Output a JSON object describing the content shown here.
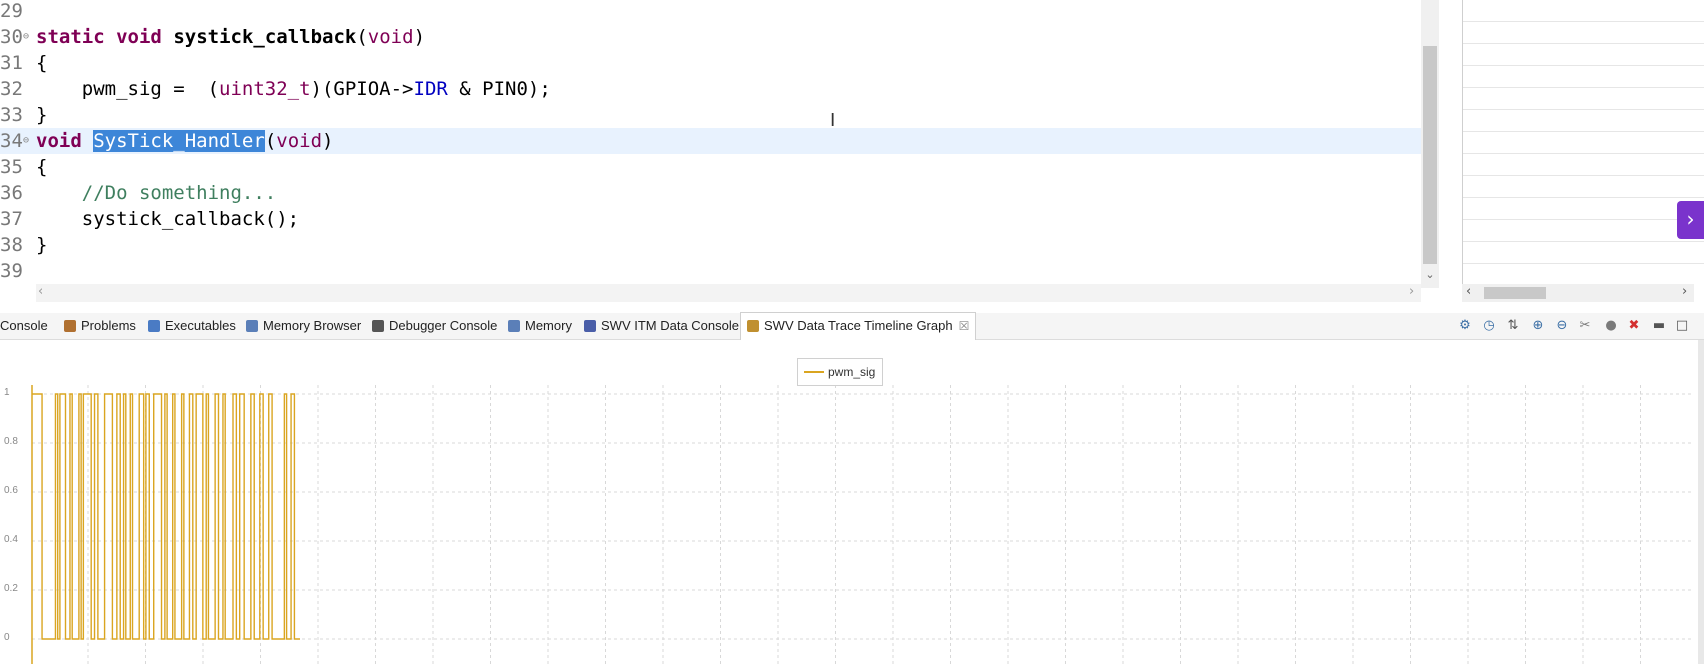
{
  "editor": {
    "lines": [
      {
        "num": "29",
        "fold": "",
        "current": false,
        "tokens": []
      },
      {
        "num": "30",
        "fold": "⊖",
        "current": false,
        "tokens": [
          {
            "c": "kw",
            "t": "static"
          },
          {
            "c": "",
            "t": " "
          },
          {
            "c": "kw",
            "t": "void"
          },
          {
            "c": "",
            "t": " "
          },
          {
            "c": "b",
            "t": "systick_callback"
          },
          {
            "c": "",
            "t": "("
          },
          {
            "c": "ty",
            "t": "void"
          },
          {
            "c": "",
            "t": ")"
          }
        ]
      },
      {
        "num": "31",
        "fold": "",
        "current": false,
        "tokens": [
          {
            "c": "",
            "t": "{"
          }
        ]
      },
      {
        "num": "32",
        "fold": "",
        "current": false,
        "tokens": [
          {
            "c": "",
            "t": "    pwm_sig =  ("
          },
          {
            "c": "ty",
            "t": "uint32_t"
          },
          {
            "c": "",
            "t": ")(GPIOA->"
          },
          {
            "c": "mac",
            "t": "IDR"
          },
          {
            "c": "",
            "t": " & PIN0);"
          }
        ]
      },
      {
        "num": "33",
        "fold": "",
        "current": false,
        "tokens": [
          {
            "c": "",
            "t": "}"
          }
        ]
      },
      {
        "num": "34",
        "fold": "⊖",
        "current": true,
        "tokens": [
          {
            "c": "kw",
            "t": "void"
          },
          {
            "c": "",
            "t": " "
          },
          {
            "c": "sel",
            "t": "SysTick_Handler"
          },
          {
            "c": "",
            "t": "("
          },
          {
            "c": "ty",
            "t": "void"
          },
          {
            "c": "",
            "t": ")"
          }
        ]
      },
      {
        "num": "35",
        "fold": "",
        "current": false,
        "tokens": [
          {
            "c": "",
            "t": "{"
          }
        ]
      },
      {
        "num": "36",
        "fold": "",
        "current": false,
        "tokens": [
          {
            "c": "",
            "t": "    "
          },
          {
            "c": "cm",
            "t": "//Do something..."
          }
        ]
      },
      {
        "num": "37",
        "fold": "",
        "current": false,
        "tokens": [
          {
            "c": "",
            "t": "    systick_callback();"
          }
        ]
      },
      {
        "num": "38",
        "fold": "",
        "current": false,
        "tokens": [
          {
            "c": "",
            "t": "}"
          }
        ]
      },
      {
        "num": "39",
        "fold": "",
        "current": false,
        "tokens": []
      }
    ],
    "cursor_glyph": "I"
  },
  "tabs": [
    {
      "label": "Console",
      "icon": "console-icon",
      "active": false
    },
    {
      "label": "Problems",
      "icon": "problems-icon",
      "active": false
    },
    {
      "label": "Executables",
      "icon": "executables-icon",
      "active": false
    },
    {
      "label": "Memory Browser",
      "icon": "memory-browser-icon",
      "active": false
    },
    {
      "label": "Debugger Console",
      "icon": "debugger-console-icon",
      "active": false
    },
    {
      "label": "Memory",
      "icon": "memory-icon",
      "active": false
    },
    {
      "label": "SWV ITM Data Console",
      "icon": "swv-itm-icon",
      "active": false
    },
    {
      "label": "SWV Data Trace Timeline Graph",
      "icon": "timeline-graph-icon",
      "active": true,
      "close": "☒"
    }
  ],
  "toolbar_icons": [
    {
      "name": "configure-trace-icon",
      "glyph": "⚙",
      "color": "#3a6ea5"
    },
    {
      "name": "time-icon",
      "glyph": "◷",
      "color": "#3a6ea5"
    },
    {
      "name": "adjust-y-axis-icon",
      "glyph": "⇅",
      "color": "#555555"
    },
    {
      "name": "zoom-in-icon",
      "glyph": "⊕",
      "color": "#3a6ea5"
    },
    {
      "name": "zoom-out-icon",
      "glyph": "⊖",
      "color": "#3a6ea5"
    },
    {
      "name": "tools-icon",
      "glyph": "✂",
      "color": "#777777"
    },
    {
      "name": "record-icon",
      "glyph": "●",
      "color": "#7a7a7a"
    },
    {
      "name": "remove-all-icon",
      "glyph": "✖",
      "color": "#d32f2f"
    },
    {
      "name": "minimize-icon",
      "glyph": "▬",
      "color": "#555555"
    },
    {
      "name": "maximize-icon",
      "glyph": "□",
      "color": "#555555"
    }
  ],
  "chart_data": {
    "type": "line",
    "series": [
      {
        "name": "pwm_sig",
        "color": "#daa520"
      }
    ],
    "ylim": [
      0,
      1
    ],
    "yticks": [
      "1",
      "0.8",
      "0.6",
      "0.4",
      "0.2",
      "0"
    ],
    "grid": true,
    "legend_position": "top-center",
    "step_transitions": [
      {
        "t": 0.0,
        "v": 1
      },
      {
        "t": 0.5,
        "v": 1
      },
      {
        "t": 0.9,
        "v": 0
      },
      {
        "t": 1.7,
        "v": 0
      },
      {
        "t": 2.1,
        "v": 1
      },
      {
        "t": 2.3,
        "v": 0
      },
      {
        "t": 2.5,
        "v": 1
      },
      {
        "t": 3.0,
        "v": 0
      },
      {
        "t": 3.4,
        "v": 1
      },
      {
        "t": 3.6,
        "v": 0
      },
      {
        "t": 4.2,
        "v": 1
      },
      {
        "t": 4.4,
        "v": 0
      },
      {
        "t": 4.6,
        "v": 1
      },
      {
        "t": 5.3,
        "v": 0
      },
      {
        "t": 5.6,
        "v": 1
      },
      {
        "t": 5.9,
        "v": 0
      },
      {
        "t": 6.5,
        "v": 1
      },
      {
        "t": 7.2,
        "v": 0
      },
      {
        "t": 7.6,
        "v": 1
      },
      {
        "t": 7.9,
        "v": 0
      },
      {
        "t": 8.2,
        "v": 1
      },
      {
        "t": 8.4,
        "v": 0
      },
      {
        "t": 8.8,
        "v": 1
      },
      {
        "t": 9.0,
        "v": 0
      },
      {
        "t": 9.6,
        "v": 1
      },
      {
        "t": 10.0,
        "v": 0
      },
      {
        "t": 10.2,
        "v": 1
      },
      {
        "t": 10.5,
        "v": 0
      },
      {
        "t": 10.9,
        "v": 1
      },
      {
        "t": 11.6,
        "v": 0
      },
      {
        "t": 11.9,
        "v": 1
      },
      {
        "t": 12.1,
        "v": 0
      },
      {
        "t": 12.6,
        "v": 1
      },
      {
        "t": 12.8,
        "v": 0
      },
      {
        "t": 13.4,
        "v": 1
      },
      {
        "t": 13.6,
        "v": 0
      },
      {
        "t": 14.1,
        "v": 1
      },
      {
        "t": 14.4,
        "v": 0
      },
      {
        "t": 14.7,
        "v": 1
      },
      {
        "t": 15.3,
        "v": 0
      },
      {
        "t": 15.6,
        "v": 1
      },
      {
        "t": 15.8,
        "v": 0
      },
      {
        "t": 16.4,
        "v": 1
      },
      {
        "t": 16.7,
        "v": 0
      },
      {
        "t": 17.1,
        "v": 1
      },
      {
        "t": 17.3,
        "v": 0
      },
      {
        "t": 18.0,
        "v": 1
      },
      {
        "t": 18.3,
        "v": 0
      },
      {
        "t": 18.6,
        "v": 1
      },
      {
        "t": 19.0,
        "v": 0
      },
      {
        "t": 19.6,
        "v": 1
      },
      {
        "t": 19.9,
        "v": 0
      },
      {
        "t": 20.4,
        "v": 1
      },
      {
        "t": 20.7,
        "v": 0
      },
      {
        "t": 21.2,
        "v": 1
      },
      {
        "t": 21.5,
        "v": 0
      },
      {
        "t": 22.6,
        "v": 1
      },
      {
        "t": 22.8,
        "v": 0
      },
      {
        "t": 23.2,
        "v": 1
      },
      {
        "t": 23.5,
        "v": 0
      },
      {
        "t": 24.0,
        "v": 0
      }
    ],
    "t_max": 24.0
  }
}
